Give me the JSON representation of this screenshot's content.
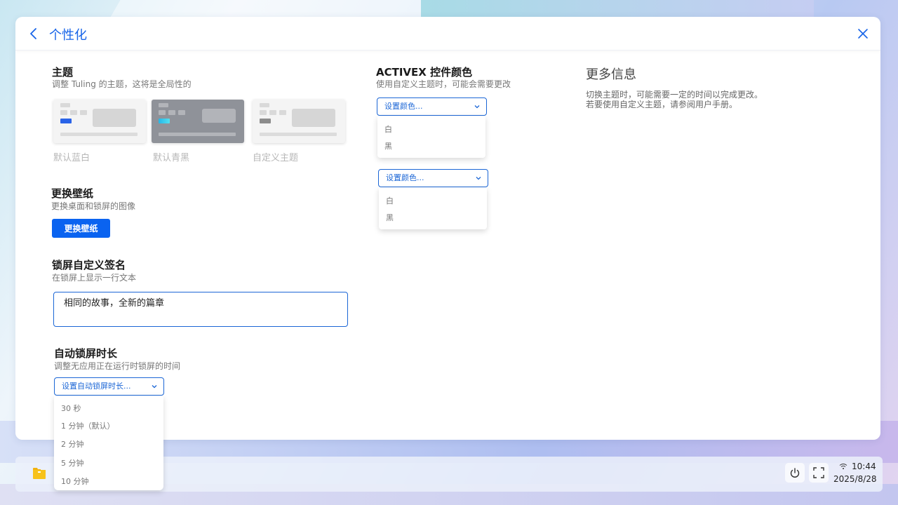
{
  "window": {
    "title": "个性化"
  },
  "theme": {
    "title": "主题",
    "description": "调整 Tuling 的主题，这将是全局性的",
    "options": [
      {
        "label": "默认蓝白"
      },
      {
        "label": "默认青黑"
      },
      {
        "label": "自定义主题"
      }
    ]
  },
  "wallpaper": {
    "title": "更换壁纸",
    "description": "更换桌面和锁屏的图像",
    "button_label": "更换壁纸"
  },
  "lock_signature": {
    "title": "锁屏自定义签名",
    "description": "在锁屏上显示一行文本",
    "value": "相同的故事，全新的篇章"
  },
  "auto_lock": {
    "title": "自动锁屏时长",
    "description": "调整无应用正在运行时锁屏的时间",
    "select_placeholder": "设置自动锁屏时长...",
    "options": [
      "30 秒",
      "1 分钟（默认）",
      "2 分钟",
      "5 分钟",
      "10 分钟"
    ]
  },
  "activex": {
    "title": "ACTIVEX 控件颜色",
    "description": "使用自定义主题时，可能会需要更改",
    "select1_placeholder": "设置颜色...",
    "select1_options": [
      "白",
      "黑"
    ],
    "select2_placeholder": "设置颜色...",
    "select2_options": [
      "白",
      "黑"
    ]
  },
  "more_info": {
    "title": "更多信息",
    "line1": "切换主题时，可能需要一定的时间以完成更改。",
    "line2": "若要使用自定义主题，请参阅用户手册。"
  },
  "taskbar": {
    "time": "10:44",
    "date": "2025/8/28"
  },
  "colors": {
    "accent": "#1764e8",
    "primary_button": "#0a63f0",
    "folder_icon": "#f7c21b"
  },
  "icons": [
    "back-icon",
    "close-icon",
    "chevron-down-icon",
    "folder-icon",
    "power-icon",
    "fullscreen-icon",
    "wifi-icon"
  ]
}
